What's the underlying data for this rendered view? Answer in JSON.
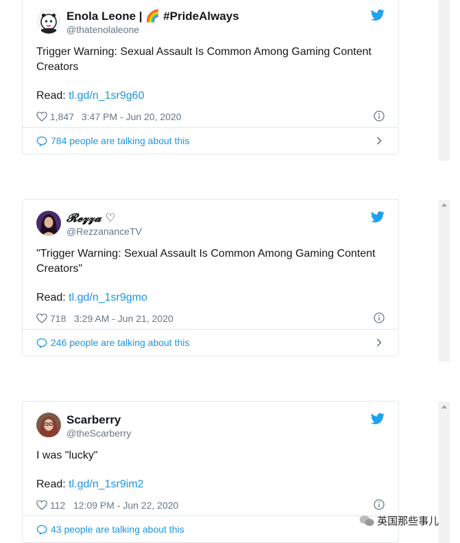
{
  "tweets": [
    {
      "name": "Enola Leone | 🌈 #PrideAlways",
      "handle": "@thatenolaleone",
      "text": "Trigger Warning: Sexual Assault Is Common Among Gaming Content Creators",
      "read_label": "Read:",
      "link": "tl.gd/n_1sr9g60",
      "likes": "1,847",
      "timestamp": "3:47 PM - Jun 20, 2020",
      "talking": "784 people are talking about this",
      "avatar_icon": "cartoon-avatar-icon"
    },
    {
      "name": "𝓡𝓮𝔃𝔃𝓪 ♡",
      "handle": "@RezzananceTV",
      "text": "\"Trigger Warning: Sexual Assault Is Common Among Gaming Content Creators\"",
      "read_label": "Read:",
      "link": "tl.gd/n_1sr9gmo",
      "likes": "718",
      "timestamp": "3:29 AM - Jun 21, 2020",
      "talking": "246 people are talking about this",
      "avatar_icon": "photo-avatar-icon"
    },
    {
      "name": "Scarberry",
      "handle": "@theScarberry",
      "text": "I was \"lucky\"",
      "read_label": "Read:",
      "link": "tl.gd/n_1sr9im2",
      "likes": "112",
      "timestamp": "12:09 PM - Jun 22, 2020",
      "talking": "43 people are talking about this",
      "avatar_icon": "photo-avatar-icon"
    }
  ],
  "watermark": "英国那些事儿",
  "colors": {
    "link": "#1b95e0",
    "muted": "#657786",
    "border": "#e1e8ed",
    "twitter_blue": "#1da1f2"
  }
}
